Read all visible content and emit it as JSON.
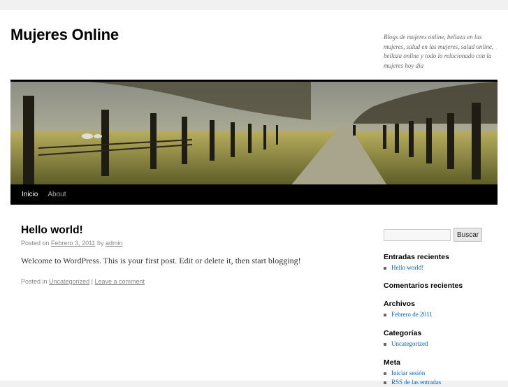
{
  "site": {
    "title": "Mujeres Online",
    "description": "Blogs de mujeres online, bellaza en las mujeres, salud en las mujeres, salud online, bellaza online y todo lo relacionado con la mujeres hoy dia"
  },
  "nav": {
    "items": [
      {
        "label": "Inicio"
      },
      {
        "label": "About"
      }
    ]
  },
  "post": {
    "title": "Hello world!",
    "posted_on": "Posted on",
    "date": "Febrero 3, 2011",
    "by": "by",
    "author": "admin",
    "content": "Welcome to WordPress. This is your first post. Edit or delete it, then start blogging!",
    "posted_in": "Posted in",
    "category": "Uncategorized",
    "separator": "|",
    "comment_link": "Leave a comment"
  },
  "sidebar": {
    "search": {
      "placeholder": "",
      "button_label": "Buscar"
    },
    "recent_posts": {
      "title": "Entradas recientes",
      "items": [
        "Hello world!"
      ]
    },
    "recent_comments": {
      "title": "Comentarios recientes"
    },
    "archives": {
      "title": "Archivos",
      "items": [
        "Febrero de 2011"
      ]
    },
    "categories": {
      "title": "Categorías",
      "items": [
        "Uncategorized"
      ]
    },
    "meta": {
      "title": "Meta",
      "items": [
        "Iniciar sesión",
        "RSS de las entradas"
      ]
    }
  },
  "colors": {
    "link": "#0066cc",
    "nav_bar": "#000000",
    "page_bg": "#f1f1f1"
  }
}
